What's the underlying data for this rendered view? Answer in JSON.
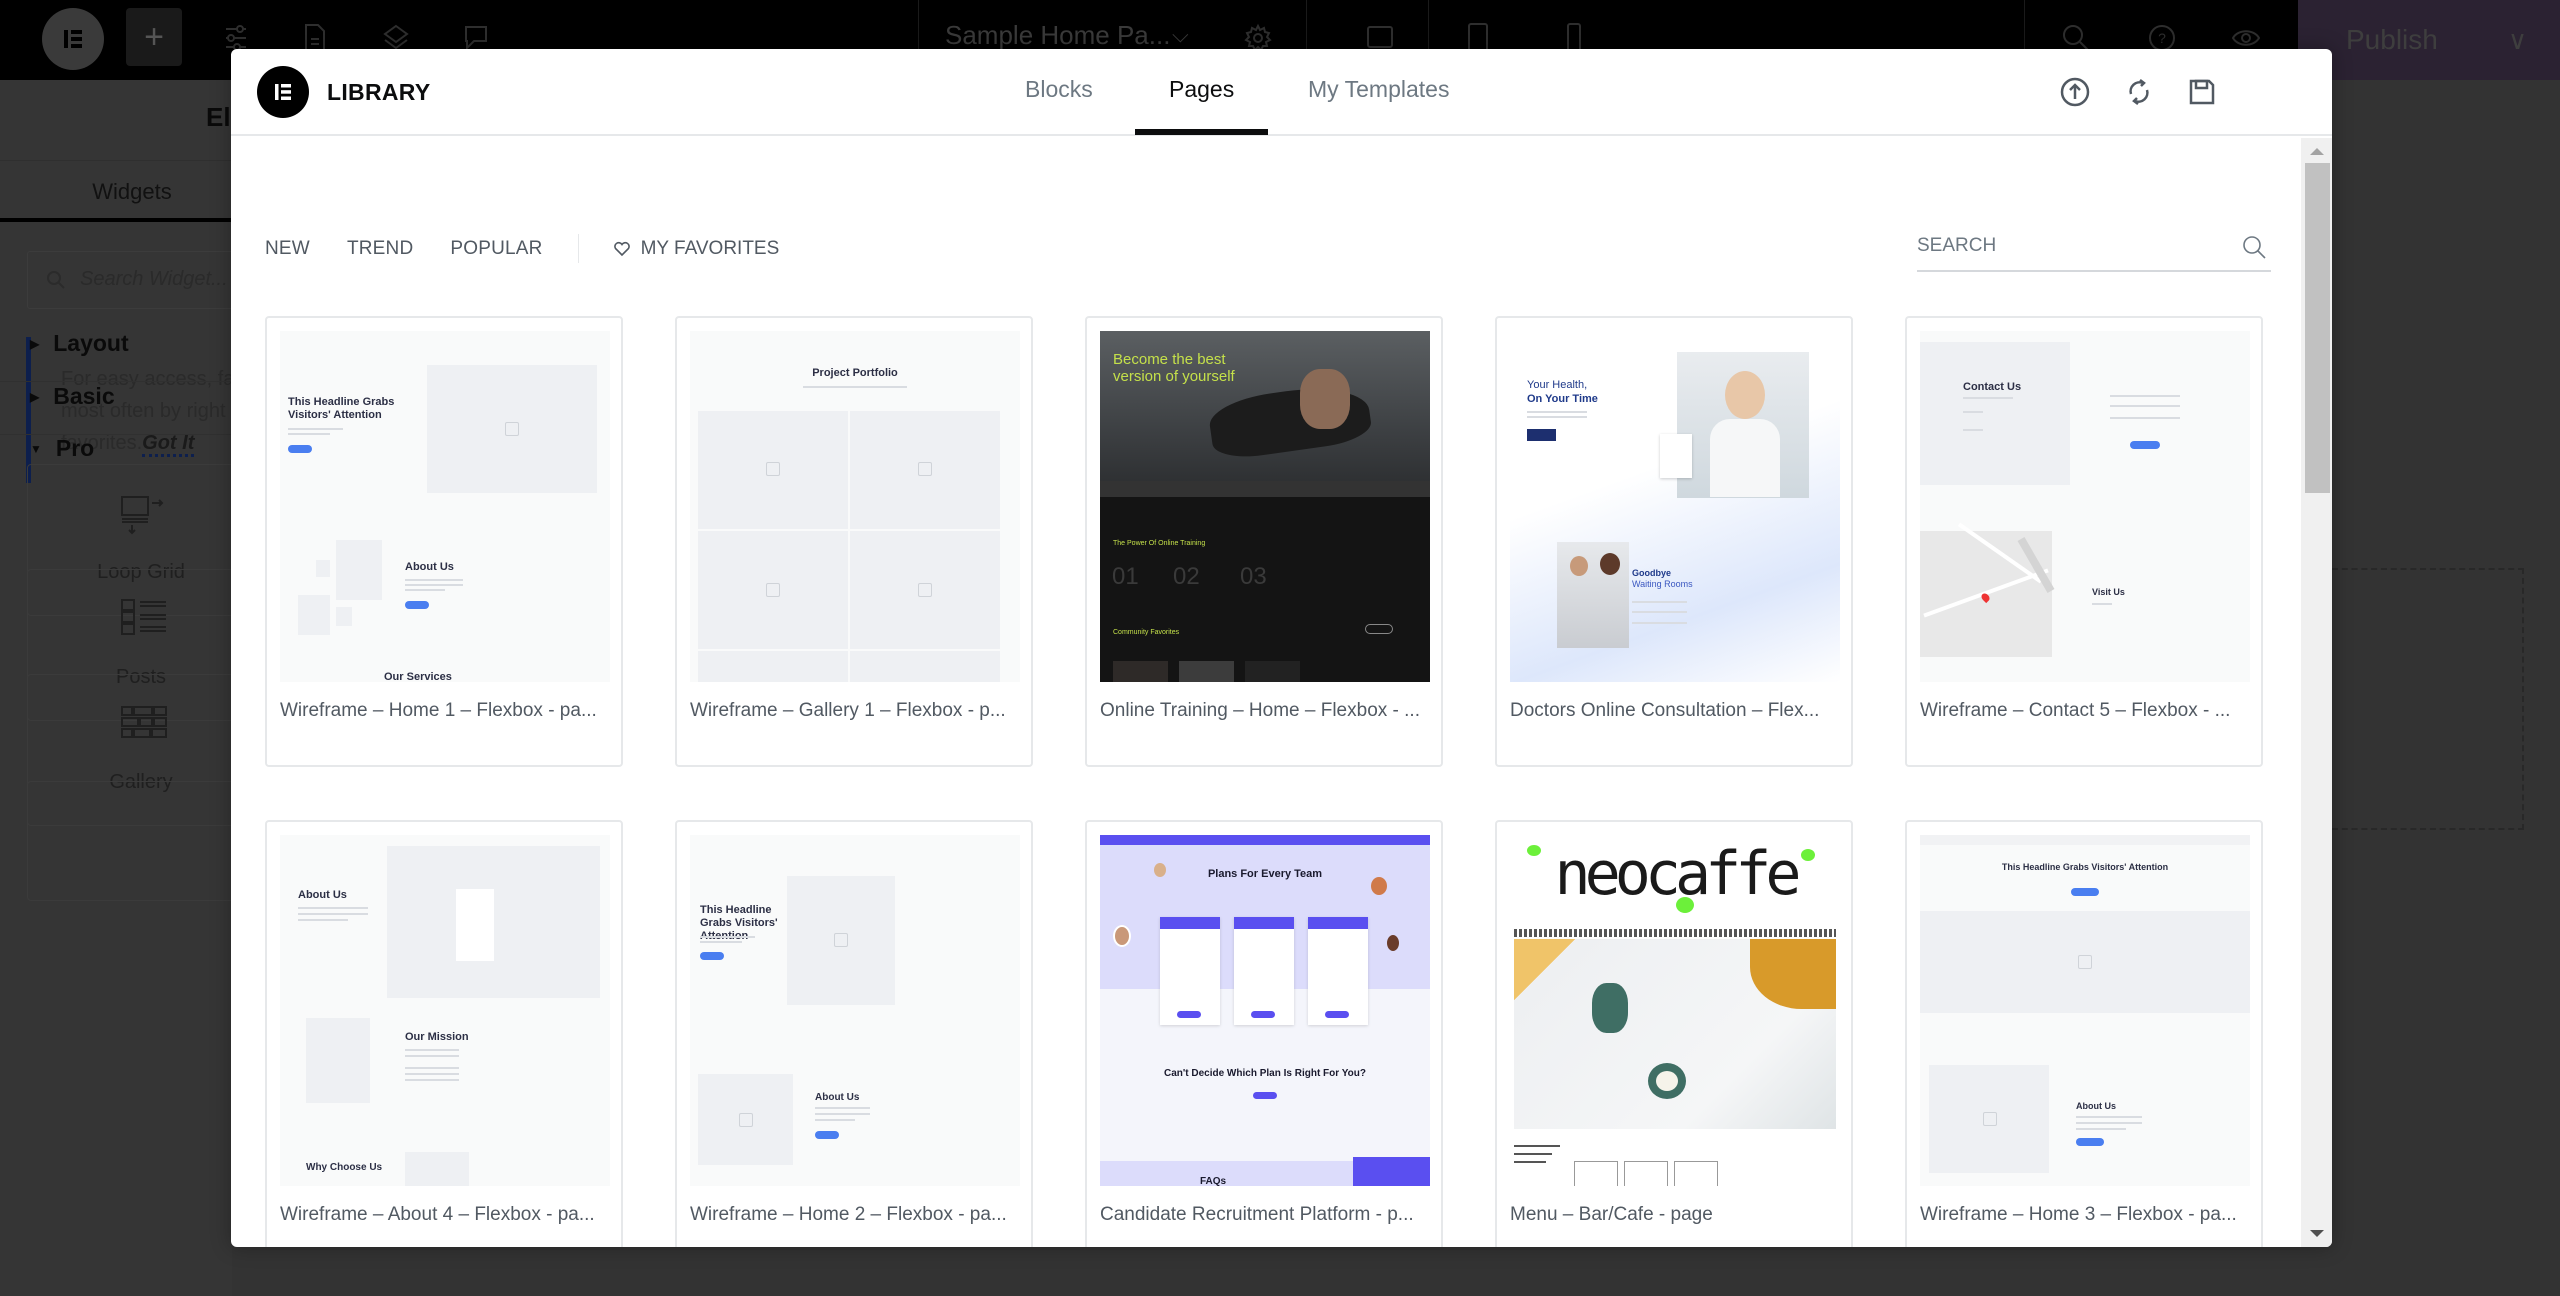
{
  "topbar": {
    "document_title": "Sample Home Pa...",
    "publish_label": "Publish",
    "icons": [
      "elementor-logo-icon",
      "add-icon",
      "site-settings-icon",
      "page-structure-icon",
      "layers-icon",
      "comments-icon",
      "settings-icon",
      "desktop-icon",
      "tablet-icon",
      "mobile-icon",
      "search-icon",
      "help-icon",
      "preview-icon",
      "chevron-down-icon"
    ]
  },
  "panel": {
    "title": "El",
    "tab": "Widgets",
    "search_placeholder": "Search Widget...",
    "note_text": "For easy access, favorite the widgets you use most often by right clicking > Add to favorites.",
    "note_line1": "For easy access, fa",
    "note_line2": "most often by right",
    "note_line3": "favorites.",
    "note_action": "Got It",
    "categories": [
      {
        "label": "Layout",
        "expanded": false
      },
      {
        "label": "Basic",
        "expanded": false
      },
      {
        "label": "Pro",
        "expanded": true
      }
    ],
    "widgets": [
      {
        "label": "Loop Grid",
        "icon": "loop-grid-icon"
      },
      {
        "label": "Posts",
        "icon": "posts-icon"
      },
      {
        "label": "Gallery",
        "icon": "gallery-icon"
      }
    ]
  },
  "library": {
    "title": "LIBRARY",
    "tabs": [
      {
        "label": "Blocks",
        "active": false
      },
      {
        "label": "Pages",
        "active": true
      },
      {
        "label": "My Templates",
        "active": false
      }
    ],
    "actions": [
      {
        "name": "import",
        "icon": "upload-icon"
      },
      {
        "name": "sync",
        "icon": "sync-icon"
      },
      {
        "name": "save",
        "icon": "save-icon"
      },
      {
        "name": "close",
        "icon": "close-icon"
      }
    ],
    "filters": [
      "NEW",
      "TREND",
      "POPULAR"
    ],
    "favorites_label": "MY FAVORITES",
    "search_placeholder": "SEARCH",
    "search_value": "",
    "templates": [
      {
        "name": "Wireframe – Home 1 – Flexbox - page",
        "display": "Wireframe – Home 1 – Flexbox - pa...",
        "preview": "wireframe-home-1"
      },
      {
        "name": "Wireframe – Gallery 1 – Flexbox - page",
        "display": "Wireframe – Gallery 1 – Flexbox - p...",
        "preview": "wireframe-gallery-1"
      },
      {
        "name": "Online Training – Home – Flexbox - page",
        "display": "Online Training – Home – Flexbox - ...",
        "preview": "online-training"
      },
      {
        "name": "Doctors Online Consultation – Flexbox - page",
        "display": "Doctors Online Consultation – Flex...",
        "preview": "doctors"
      },
      {
        "name": "Wireframe – Contact 5 – Flexbox - page",
        "display": "Wireframe – Contact 5 – Flexbox - ...",
        "preview": "wireframe-contact-5"
      },
      {
        "name": "Wireframe – About 4 – Flexbox - page",
        "display": "Wireframe – About 4 – Flexbox - pa...",
        "preview": "wireframe-about-4"
      },
      {
        "name": "Wireframe – Home 2 – Flexbox - page",
        "display": "Wireframe – Home 2 – Flexbox - pa...",
        "preview": "wireframe-home-2"
      },
      {
        "name": "Candidate Recruitment Platform - page",
        "display": "Candidate Recruitment Platform - p...",
        "preview": "recruitment"
      },
      {
        "name": "Menu – Bar/Cafe - page",
        "display": "Menu – Bar/Cafe - page",
        "preview": "neocaffe"
      },
      {
        "name": "Wireframe – Home 3 – Flexbox - page",
        "display": "Wireframe – Home 3 – Flexbox - pa...",
        "preview": "wireframe-home-3"
      }
    ],
    "thumb_text": {
      "headline": "This Headline Grabs Visitors' Attention",
      "about": "About Us",
      "services": "Our Services",
      "portfolio": "Project Portfolio",
      "training_hero": "Become the best version of yourself",
      "training_power": "The Power Of Online Training",
      "training_nums": [
        "01",
        "02",
        "03"
      ],
      "training_fav": "Community Favorites",
      "doctor_hero1": "Your Health,",
      "doctor_hero2": "On Your Time",
      "doctor_wait1": "Goodbye",
      "doctor_wait2": "Waiting Rooms",
      "contact": "Contact Us",
      "visit": "Visit Us",
      "mission": "Our Mission",
      "why": "Why Choose Us",
      "plans": "Plans For Every Team",
      "plans_q": "Can't Decide Which Plan Is Right For You?",
      "faqs": "FAQs",
      "neocaffe": "neocaffe"
    }
  },
  "colors": {
    "accent_blue": "#4a7ef0",
    "tab_active": "#0c0d0e",
    "text_muted": "#6d7882",
    "publish_bg": "#2b2232",
    "training_green": "#c4e04a",
    "recruit_purple": "#5a4ff0",
    "neocaffe_green": "#6cf03a"
  }
}
